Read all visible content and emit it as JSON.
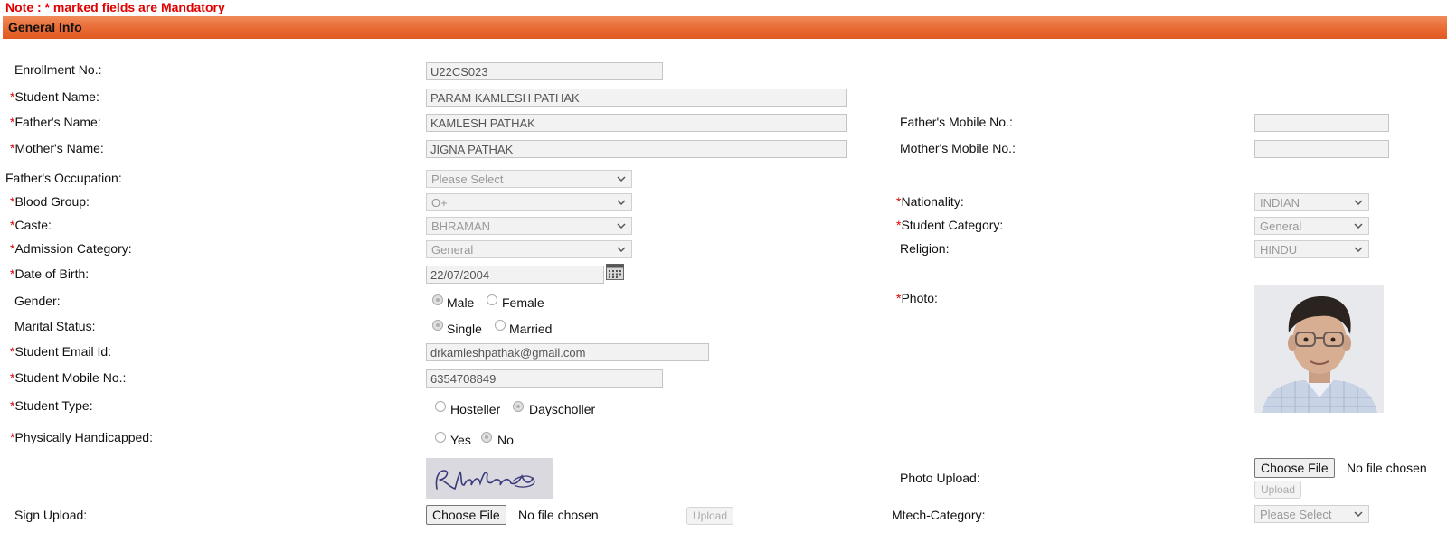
{
  "note": "Note : * marked fields are Mandatory",
  "section_title": "General Info",
  "req_mark": "*",
  "fields": {
    "enrollment": {
      "label": "Enrollment No.:",
      "value": "U22CS023"
    },
    "student_name": {
      "label": "Student Name:",
      "value": "PARAM KAMLESH PATHAK"
    },
    "father_name": {
      "label": "Father's Name:",
      "value": "KAMLESH PATHAK"
    },
    "mother_name": {
      "label": "Mother's Name:",
      "value": "JIGNA PATHAK"
    },
    "father_mobile": {
      "label": "Father's Mobile No.:",
      "value": ""
    },
    "mother_mobile": {
      "label": "Mother's Mobile No.:",
      "value": ""
    },
    "father_occupation": {
      "label": "Father's Occupation:",
      "value": "Please Select"
    },
    "blood_group": {
      "label": "Blood Group:",
      "value": "O+"
    },
    "nationality": {
      "label": "Nationality:",
      "value": "INDIAN"
    },
    "caste": {
      "label": "Caste:",
      "value": "BHRAMAN"
    },
    "student_category": {
      "label": "Student Category:",
      "value": "General"
    },
    "admission_category": {
      "label": "Admission Category:",
      "value": "General"
    },
    "religion": {
      "label": "Religion:",
      "value": "HINDU"
    },
    "dob": {
      "label": "Date of Birth:",
      "value": "22/07/2004"
    },
    "gender": {
      "label": "Gender:",
      "options": [
        "Male",
        "Female"
      ],
      "selected": "Male"
    },
    "photo": {
      "label": "Photo:"
    },
    "marital_status": {
      "label": "Marital Status:",
      "options": [
        "Single",
        "Married"
      ],
      "selected": "Single"
    },
    "email": {
      "label": "Student Email Id:",
      "value": "drkamleshpathak@gmail.com"
    },
    "mobile": {
      "label": "Student Mobile No.:",
      "value": "6354708849"
    },
    "student_type": {
      "label": "Student Type:",
      "options": [
        "Hosteller",
        "Dayscholler"
      ],
      "selected": "Dayscholler"
    },
    "handicapped": {
      "label": "Physically Handicapped:",
      "options": [
        "Yes",
        "No"
      ],
      "selected": "No"
    },
    "sign_upload": {
      "label": "Sign Upload:",
      "signature_text": "Rhathak"
    },
    "photo_upload": {
      "label": "Photo Upload:"
    },
    "mtech_category": {
      "label": "Mtech-Category:",
      "value": "Please Select"
    }
  },
  "file_input": {
    "button": "Choose File",
    "status": "No file chosen",
    "upload": "Upload"
  },
  "colors": {
    "required": "#e00000",
    "header": "#e86a33"
  },
  "icons": {
    "calendar": "calendar-icon",
    "dropdown": "chevron-down-icon"
  }
}
